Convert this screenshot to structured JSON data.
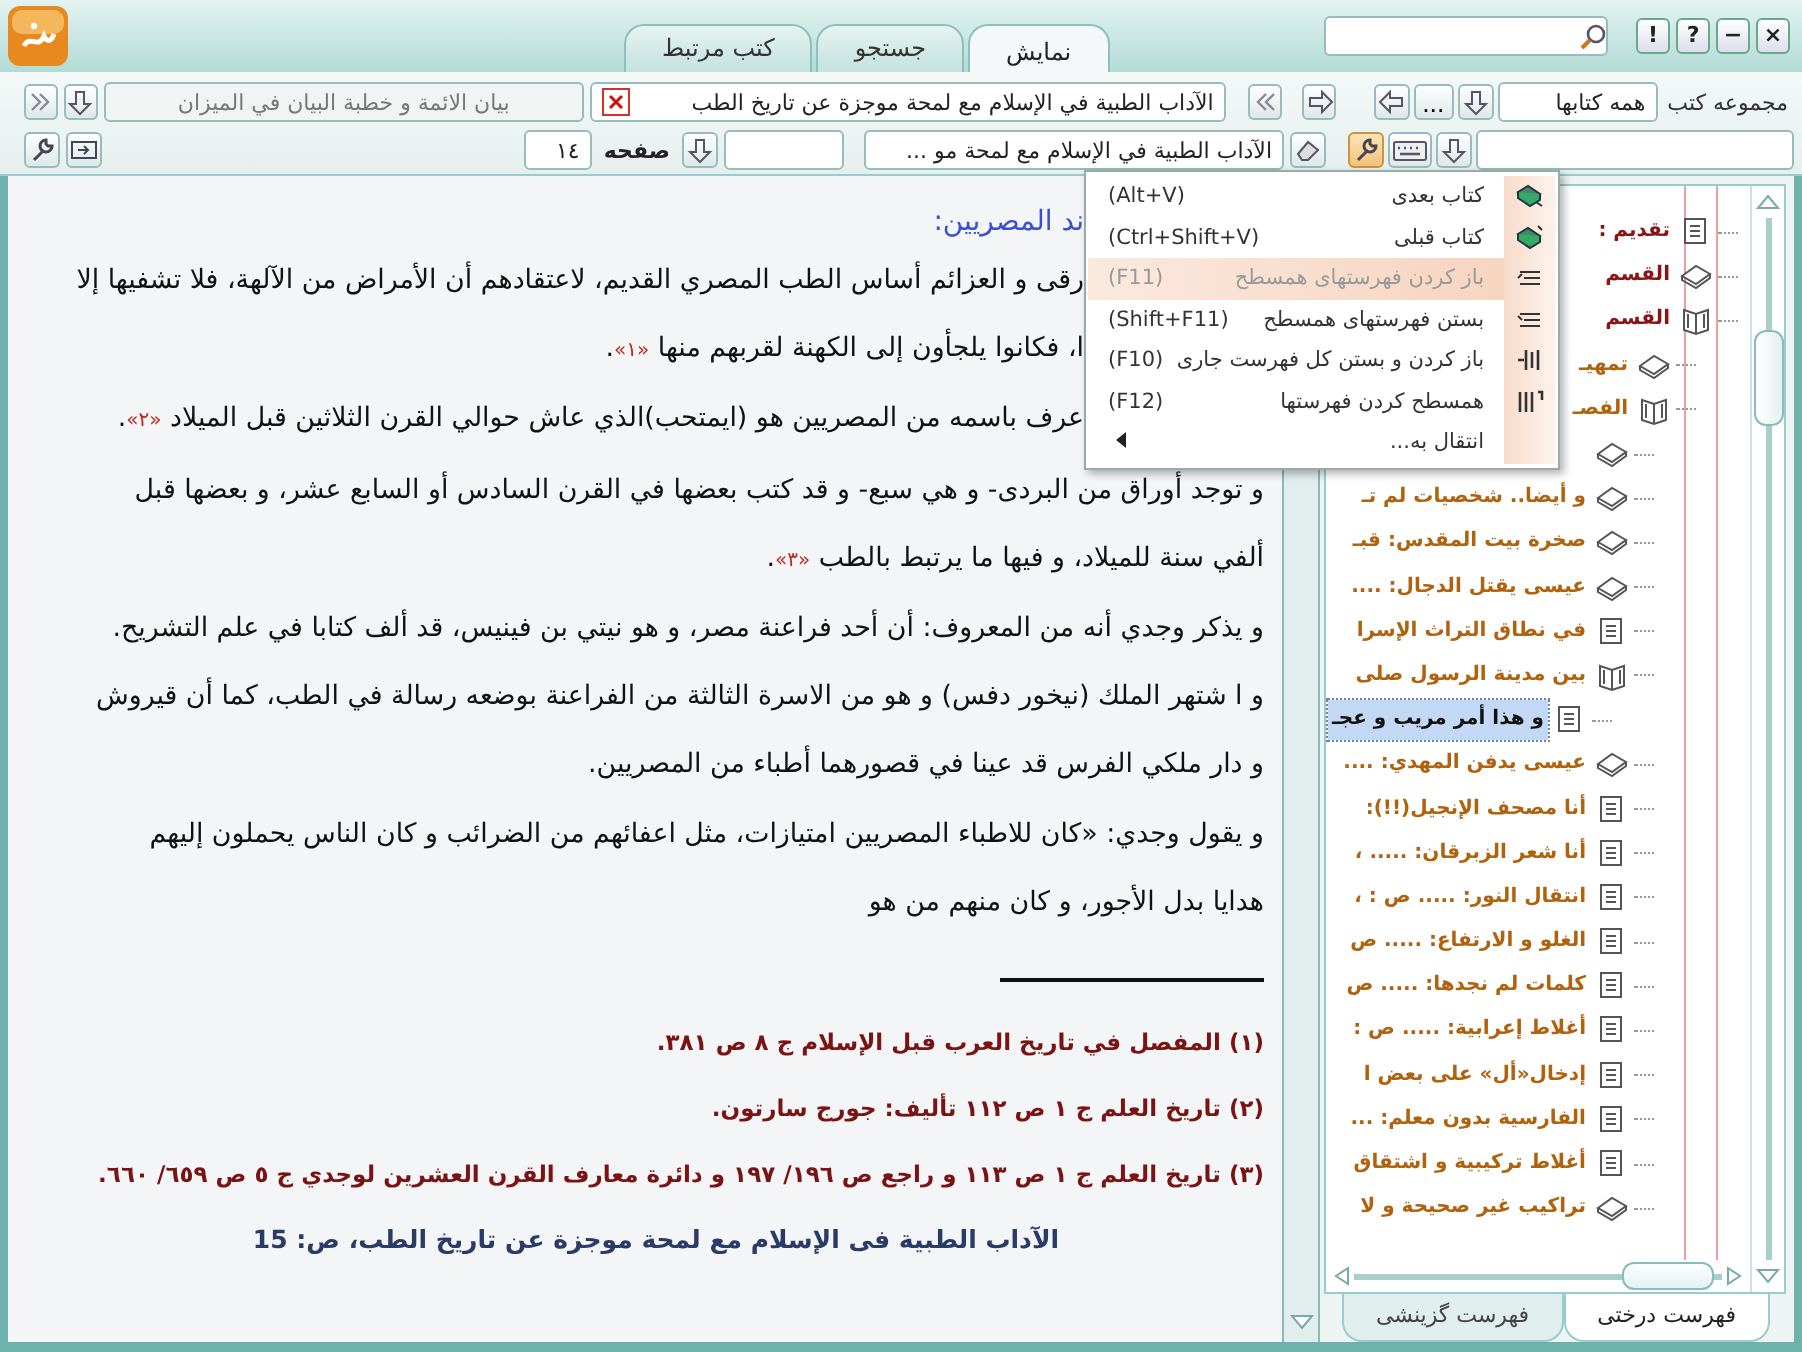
{
  "title_bar": {
    "tabs": [
      {
        "label": "نمایش",
        "selected": true
      },
      {
        "label": "جستجو",
        "selected": false
      },
      {
        "label": "کتب مرتبط",
        "selected": false
      }
    ],
    "buttons": [
      "×",
      "−",
      "?",
      "!"
    ]
  },
  "toolbar": {
    "current_book": "الآداب الطبية في الإسلام مع لمحة موجزة عن تاريخ الطب",
    "other_book": "بيان الائمة و خطبة البيان في الميزان",
    "book_select": "الآداب الطبية في الإسلام مع لمحة مو ...",
    "page_label": "صفحه",
    "page": "١٤",
    "collection_label": "مجموعه کتب",
    "collection": "همه کتابها",
    "more": "..."
  },
  "document": {
    "heading": "ند المصريين:",
    "lines": [
      [
        {
          "kind": "text",
          "text": "رقى و العزائم أساس الطب المصري القديم، لاعتقادهم أن الأمراض من الآلهة، فلا تشفيها إلا"
        }
      ],
      [
        {
          "kind": "text",
          "text": "ا، فكانوا يلجأون إلى الكهنة لقربهم منها "
        },
        {
          "kind": "note",
          "text": "«١»"
        },
        {
          "kind": "text",
          "text": "."
        }
      ],
      [
        {
          "kind": "text",
          "text": "عرف باسمه من المصريين هو (ايمتحب)الذي عاش حوالي القرن الثلاثين قبل الميلاد "
        },
        {
          "kind": "note",
          "text": "«٢»"
        },
        {
          "kind": "text",
          "text": "."
        }
      ],
      [
        {
          "kind": "text",
          "text": "و توجد أوراق من البردى- و هي سبع- و قد كتب بعضها في القرن السادس أو السابع عشر، و بعضها قبل"
        }
      ],
      [
        {
          "kind": "text",
          "text": "ألفي سنة للميلاد، و فيها ما يرتبط بالطب "
        },
        {
          "kind": "note",
          "text": "«٣»"
        },
        {
          "kind": "text",
          "text": "."
        }
      ],
      [
        {
          "kind": "text",
          "text": "و يذكر وجدي أنه من المعروف: أن أحد فراعنة مصر، و هو نيتي بن فينيس، قد ألف كتابا في علم التشريح."
        }
      ],
      [
        {
          "kind": "text",
          "text": "و ا شتهر الملك (نيخور دفس) و هو من الاسرة الثالثة من الفراعنة بوضعه رسالة في الطب، كما أن قيروش"
        }
      ],
      [
        {
          "kind": "text",
          "text": "و دار ملكي الفرس قد عينا في قصورهما أطباء من المصريين."
        }
      ],
      [
        {
          "kind": "text",
          "text": "و يقول وجدي: «كان للاطباء المصريين امتيازات، مثل اعفائهم من الضرائب و كان الناس يحملون إليهم"
        }
      ],
      [
        {
          "kind": "text",
          "text": "هدايا بدل الأجور، و كان منهم من هو"
        }
      ]
    ],
    "footnotes": [
      "(١) المفصل في تاريخ العرب قبل الإسلام ج ٨ ص ٣٨١.",
      "(٢) تاريخ العلم ج ١ ص ١١٢ تأليف: جورج سارتون.",
      "(٣) تاريخ العلم ج ١ ص ١١٣ و راجع ص ١٩٦/ ١٩٧ و دائرة معارف القرن العشرين لوجدي ج ٥ ص ٦٥٩/ ٦٦٠."
    ],
    "page_footer": "الآداب الطبية فى الإسلام مع لمحة موجزة عن تاريخ الطب، ص: 15"
  },
  "context_menu": [
    {
      "kind": "command",
      "label": "کتاب بعدی",
      "shortcut": "(Alt+V)",
      "disabled": false,
      "selected": false
    },
    {
      "kind": "command",
      "label": "کتاب قبلی",
      "shortcut": "(Ctrl+Shift+V)",
      "disabled": false,
      "selected": false
    },
    {
      "kind": "command",
      "label": "باز کردن فهرستهای همسطح",
      "shortcut": "(F11)",
      "disabled": true,
      "selected": true
    },
    {
      "kind": "command",
      "label": "بستن فهرستهای همسطح",
      "shortcut": "(Shift+F11)",
      "disabled": false,
      "selected": false
    },
    {
      "kind": "command",
      "label": "باز کردن و بستن کل فهرست جاری",
      "shortcut": "(F10)",
      "disabled": false,
      "selected": false
    },
    {
      "kind": "command",
      "label": "همسطح کردن فهرستها",
      "shortcut": "(F12)",
      "disabled": false,
      "selected": false
    },
    {
      "kind": "submenu",
      "label": "انتقال به...",
      "disabled": false,
      "selected": false
    }
  ],
  "tree": {
    "items": [
      {
        "kind": "page",
        "label": "تقديم :",
        "selected": false
      },
      {
        "kind": "book",
        "label": "القسم",
        "selected": false
      },
      {
        "kind": "open-book",
        "label": "القسم",
        "selected": false,
        "children": [
          {
            "kind": "book",
            "label": "تمهيـ",
            "selected": false
          },
          {
            "kind": "open-book",
            "label": "الفصـ",
            "selected": false,
            "children": [
              {
                "kind": "book"
              },
              {
                "kind": "book",
                "label": "و أيضا.. شخصيات لم تـ",
                "selected": false
              },
              {
                "kind": "book",
                "label": "صخرة بيت المقدس: قبـ",
                "selected": false
              },
              {
                "kind": "book",
                "label": "عيسى يقتل الدجال: ....",
                "selected": false
              },
              {
                "kind": "page",
                "label": "في نطاق التراث الإسرا",
                "selected": false
              },
              {
                "kind": "open-book",
                "label": "بين مدينة الرسول صلى",
                "selected": false,
                "children": [
                  {
                    "kind": "page",
                    "label": "و هذا أمر مريب و عجـ",
                    "selected": true
                  }
                ]
              },
              {
                "kind": "book",
                "label": "عيسى يدفن المهدي: ....",
                "selected": false
              },
              {
                "kind": "page",
                "label": "أنا مصحف الإنجيل(!!):",
                "selected": false
              },
              {
                "kind": "page",
                "label": "أنا شعر الزبرقان: ..... ،",
                "selected": false
              },
              {
                "kind": "page",
                "label": "انتقال النور: ..... ص : ،",
                "selected": false
              },
              {
                "kind": "page",
                "label": "الغلو و الارتفاع: ..... ص",
                "selected": false
              },
              {
                "kind": "page",
                "label": "كلمات لم نجدها: ..... ص",
                "selected": false
              },
              {
                "kind": "page",
                "label": "أغلاط إعرابية: ..... ص :",
                "selected": false
              },
              {
                "kind": "page",
                "label": "إدخال«أل» على بعض ا",
                "selected": false
              },
              {
                "kind": "page",
                "label": "الفارسية بدون معلم: ...",
                "selected": false
              },
              {
                "kind": "page",
                "label": "أغلاط تركيبية و اشتقاق",
                "selected": false
              },
              {
                "kind": "book",
                "label": "تراكيب غير صحيحة و لا",
                "selected": false
              }
            ]
          }
        ]
      }
    ],
    "tabs": [
      {
        "label": "فهرست درختی",
        "selected": true
      },
      {
        "label": "فهرست گزینشی",
        "selected": false
      }
    ]
  }
}
